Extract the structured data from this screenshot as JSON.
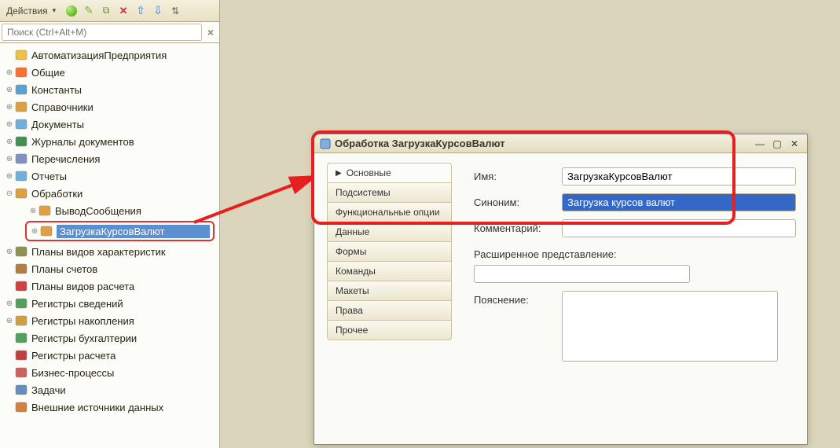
{
  "toolbar": {
    "actions_label": "Действия"
  },
  "search": {
    "placeholder": "Поиск (Ctrl+Alt+M)"
  },
  "tree": {
    "items": [
      {
        "label": "АвтоматизацияПредприятия",
        "icon": "globe",
        "expand": ""
      },
      {
        "label": "Общие",
        "icon": "common",
        "expand": "⊕"
      },
      {
        "label": "Константы",
        "icon": "constants",
        "expand": "⊕"
      },
      {
        "label": "Справочники",
        "icon": "catalogs",
        "expand": "⊕"
      },
      {
        "label": "Документы",
        "icon": "documents",
        "expand": "⊕"
      },
      {
        "label": "Журналы документов",
        "icon": "journals",
        "expand": "⊕"
      },
      {
        "label": "Перечисления",
        "icon": "enums",
        "expand": "⊕"
      },
      {
        "label": "Отчеты",
        "icon": "reports",
        "expand": "⊕"
      },
      {
        "label": "Обработки",
        "icon": "dataprocessors",
        "expand": "⊖"
      },
      {
        "label": "ВыводСообщения",
        "icon": "dataprocessor-item",
        "expand": "⊕",
        "indent": 2
      },
      {
        "label": "ЗагрузкаКурсовВалют",
        "icon": "dataprocessor-item",
        "expand": "⊕",
        "indent": 2,
        "selected": true
      },
      {
        "label": "Планы видов характеристик",
        "icon": "charplans",
        "expand": "⊕"
      },
      {
        "label": "Планы счетов",
        "icon": "accounts",
        "expand": ""
      },
      {
        "label": "Планы видов расчета",
        "icon": "calcplans",
        "expand": ""
      },
      {
        "label": "Регистры сведений",
        "icon": "inforeg",
        "expand": "⊕"
      },
      {
        "label": "Регистры накопления",
        "icon": "accumreg",
        "expand": "⊕"
      },
      {
        "label": "Регистры бухгалтерии",
        "icon": "accreg",
        "expand": ""
      },
      {
        "label": "Регистры расчета",
        "icon": "calcreg",
        "expand": ""
      },
      {
        "label": "Бизнес-процессы",
        "icon": "bp",
        "expand": ""
      },
      {
        "label": "Задачи",
        "icon": "tasks",
        "expand": ""
      },
      {
        "label": "Внешние источники данных",
        "icon": "extdata",
        "expand": ""
      }
    ]
  },
  "dialog": {
    "title": "Обработка ЗагрузкаКурсовВалют",
    "nav": [
      "Основные",
      "Подсистемы",
      "Функциональные опции",
      "Данные",
      "Формы",
      "Команды",
      "Макеты",
      "Права",
      "Прочее"
    ],
    "nav_active_index": 0,
    "form": {
      "name_label": "Имя:",
      "name_value": "ЗагрузкаКурсовВалют",
      "synonym_label": "Синоним:",
      "synonym_value": "Загрузка курсов валют",
      "comment_label": "Комментарий:",
      "comment_value": "",
      "extended_label": "Расширенное представление:",
      "extended_value": "",
      "explanation_label": "Пояснение:",
      "explanation_value": ""
    }
  }
}
